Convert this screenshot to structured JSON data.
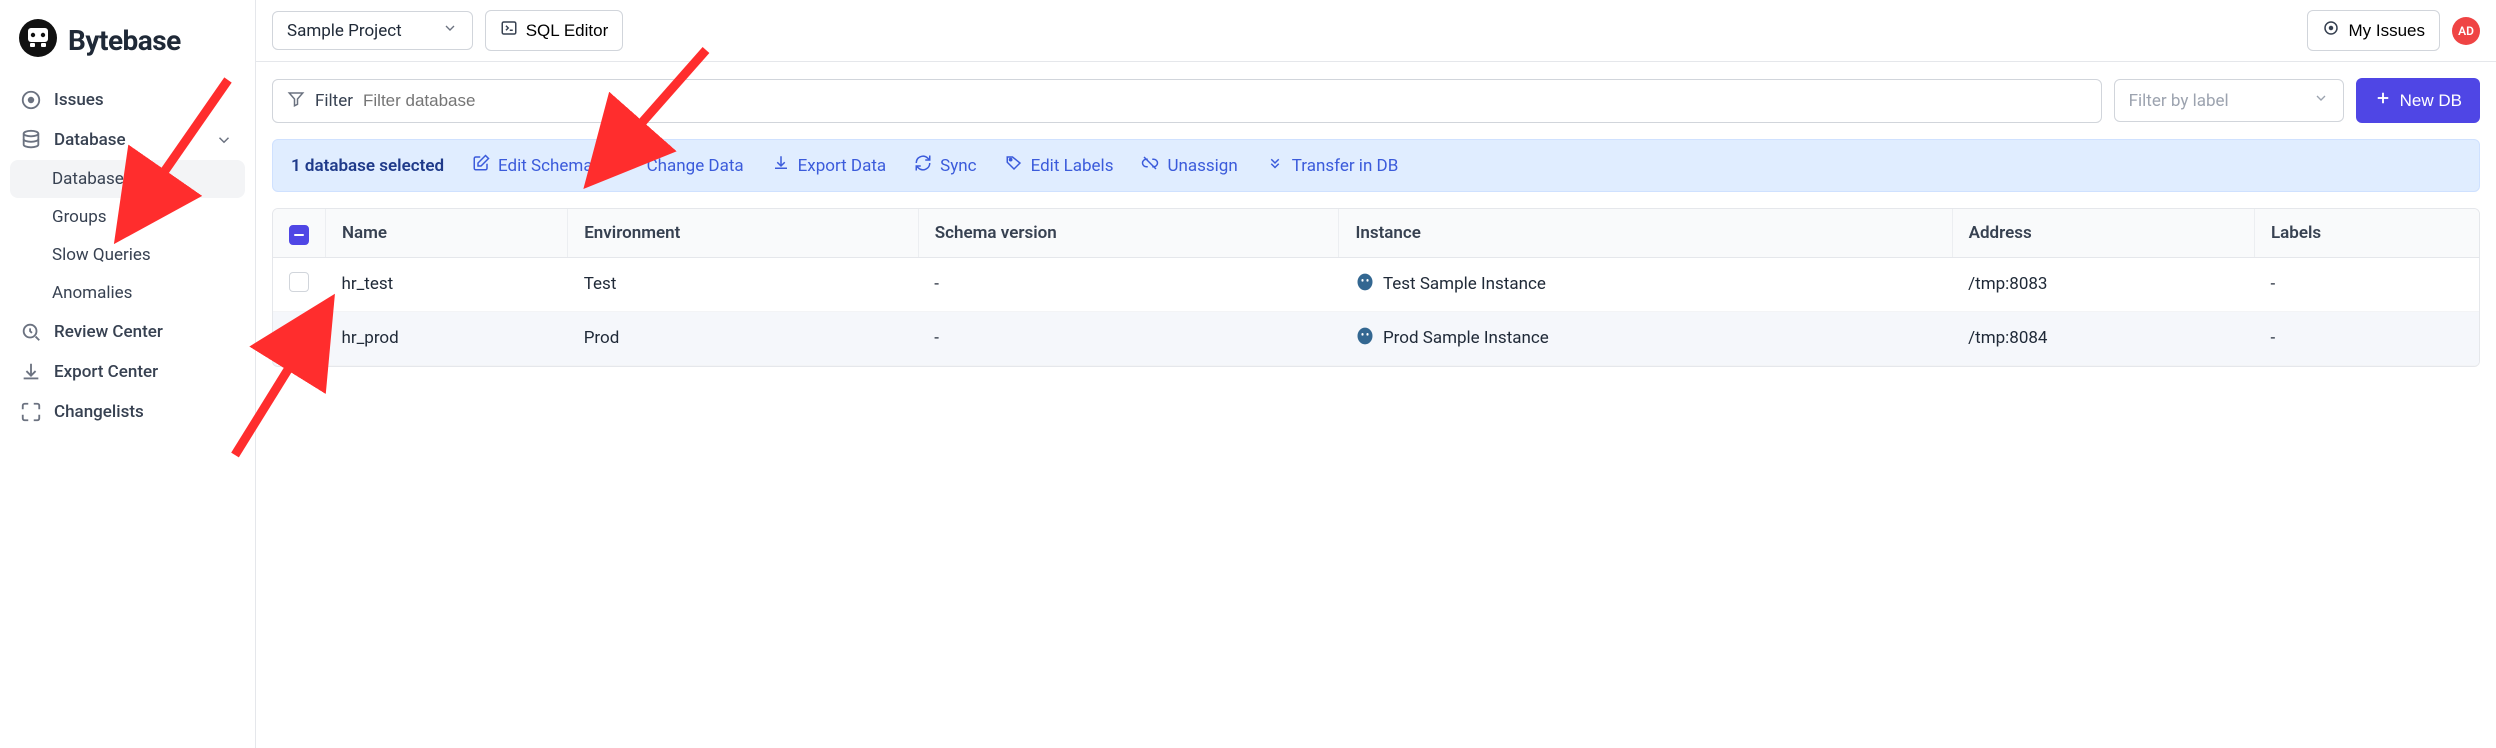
{
  "brand": {
    "name": "Bytebase"
  },
  "sidebar": {
    "items": [
      {
        "label": "Issues"
      },
      {
        "label": "Database"
      },
      {
        "label": "Databases"
      },
      {
        "label": "Groups"
      },
      {
        "label": "Slow Queries"
      },
      {
        "label": "Anomalies"
      },
      {
        "label": "Review Center"
      },
      {
        "label": "Export Center"
      },
      {
        "label": "Changelists"
      }
    ]
  },
  "topbar": {
    "project": "Sample Project",
    "sql_editor": "SQL Editor",
    "my_issues": "My Issues",
    "avatar": "AD"
  },
  "filters": {
    "label": "Filter",
    "placeholder": "Filter database",
    "label_filter_placeholder": "Filter by label",
    "new_db": "New DB"
  },
  "action_bar": {
    "selected_text": "1 database selected",
    "edit_schema": "Edit Schema",
    "change_data": "Change Data",
    "export_data": "Export Data",
    "sync": "Sync",
    "edit_labels": "Edit Labels",
    "unassign": "Unassign",
    "transfer": "Transfer in DB"
  },
  "table": {
    "headers": {
      "name": "Name",
      "environment": "Environment",
      "schema_version": "Schema version",
      "instance": "Instance",
      "address": "Address",
      "labels": "Labels"
    },
    "rows": [
      {
        "selected": false,
        "name": "hr_test",
        "environment": "Test",
        "schema_version": "-",
        "instance": "Test Sample Instance",
        "address": "/tmp:8083",
        "labels": "-"
      },
      {
        "selected": true,
        "name": "hr_prod",
        "environment": "Prod",
        "schema_version": "-",
        "instance": "Prod Sample Instance",
        "address": "/tmp:8084",
        "labels": "-"
      }
    ]
  }
}
